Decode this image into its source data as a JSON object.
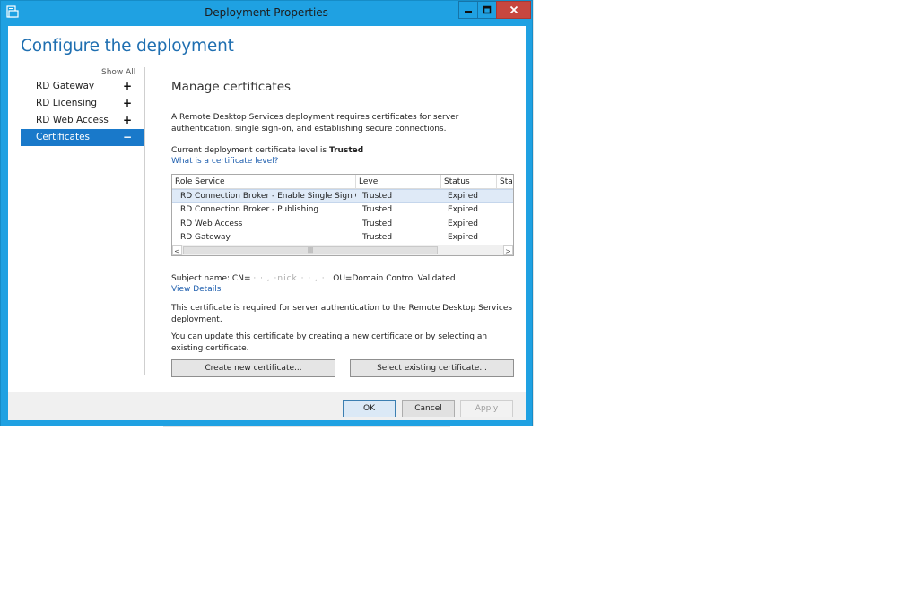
{
  "window": {
    "title": "Deployment Properties",
    "controls": {
      "minimize": "minimize",
      "maximize": "maximize",
      "close": "close"
    }
  },
  "heading": "Configure the deployment",
  "nav": {
    "show_all": "Show All",
    "items": [
      {
        "label": "RD Gateway",
        "toggle": "+"
      },
      {
        "label": "RD Licensing",
        "toggle": "+"
      },
      {
        "label": "RD Web Access",
        "toggle": "+"
      },
      {
        "label": "Certificates",
        "toggle": "−",
        "selected": true
      }
    ]
  },
  "certs": {
    "title": "Manage certificates",
    "description": "A Remote Desktop Services deployment requires certificates for server authentication, single sign-on, and establishing secure connections.",
    "level_prefix": "Current deployment certificate level is",
    "level_value": "Trusted",
    "level_link": "What is a certificate level?",
    "table": {
      "columns": [
        "Role Service",
        "Level",
        "Status",
        "Stat"
      ],
      "rows": [
        {
          "role": "RD Connection Broker - Enable Single Sign On",
          "level": "Trusted",
          "status": "Expired",
          "selected": true
        },
        {
          "role": "RD Connection Broker - Publishing",
          "level": "Trusted",
          "status": "Expired"
        },
        {
          "role": "RD Web Access",
          "level": "Trusted",
          "status": "Expired"
        },
        {
          "role": "RD Gateway",
          "level": "Trusted",
          "status": "Expired"
        }
      ],
      "scroll_left": "<",
      "scroll_right": ">",
      "scroll_grip": "|||"
    },
    "subject_prefix": "Subject name: CN=",
    "subject_redacted": "·  ·  ,  ·nick  ·  ·  ,  ·",
    "subject_ou": "OU=Domain Control Validated",
    "view_details": "View Details",
    "required_text": "This certificate is required for server authentication to the Remote Desktop Services deployment.",
    "update_text": "You can update this certificate by creating a new certificate or by selecting an existing certificate.",
    "create_button": "Create new certificate...",
    "select_button": "Select existing certificate..."
  },
  "footer": {
    "ok": "OK",
    "cancel": "Cancel",
    "apply": "Apply"
  },
  "colors": {
    "window_frame": "#1fa1e2",
    "close_button": "#c7473f",
    "heading": "#1f6fb1",
    "nav_selected": "#1979ca",
    "link": "#1f5fae"
  }
}
